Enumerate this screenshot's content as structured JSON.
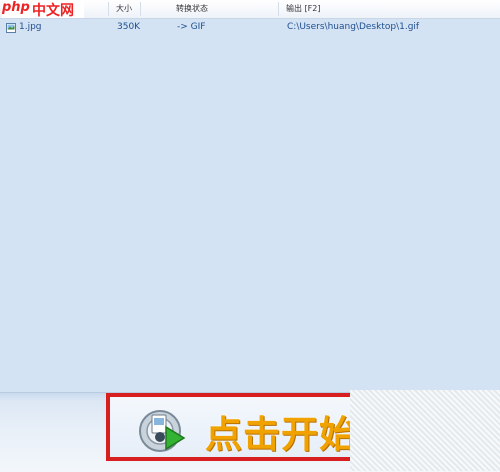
{
  "logo": {
    "en": "php",
    "cn": "中文网"
  },
  "columns": {
    "size": "大小",
    "status": "转换状态",
    "output": "输出 [F2]"
  },
  "files": [
    {
      "name": "1.jpg",
      "size": "350K",
      "status": "-> GIF",
      "output": "C:\\Users\\huang\\Desktop\\1.gif",
      "icon": "image-file-icon"
    }
  ],
  "toolbar": {
    "start_label": "点击开始",
    "start_icon": "convert-start-icon"
  },
  "colors": {
    "list_bg": "#d4e3f3",
    "text": "#1f4f8f",
    "button_border": "#d81f1f",
    "button_text": "#f0a300"
  }
}
